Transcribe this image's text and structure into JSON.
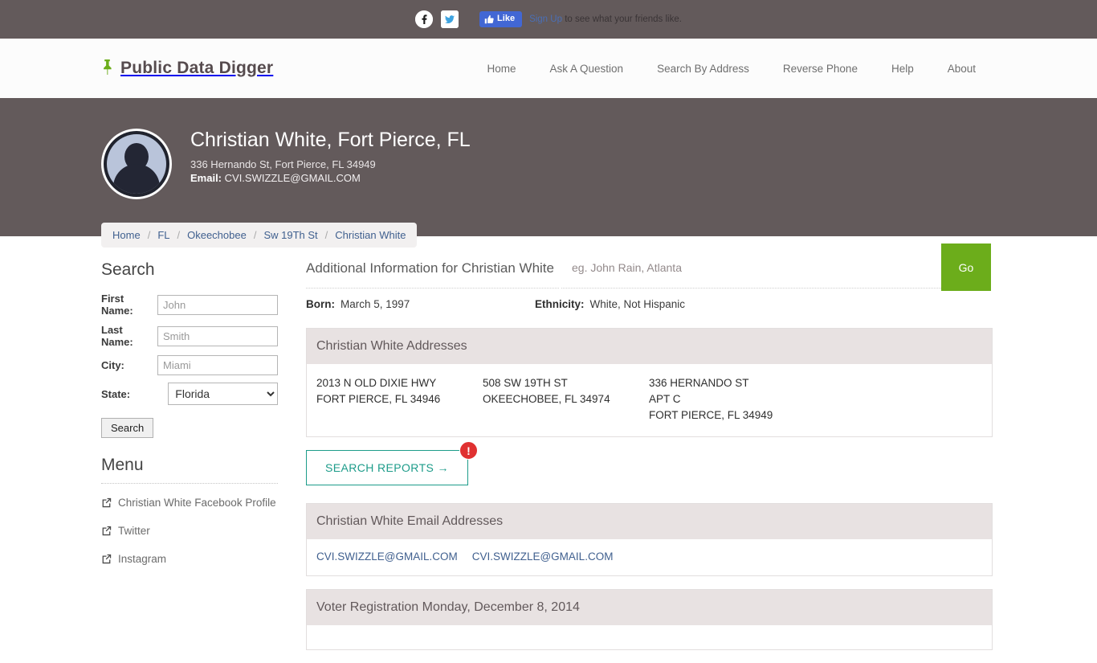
{
  "topbar": {
    "facebook_icon": "facebook-icon",
    "twitter_icon": "twitter-icon",
    "like_label": "Like",
    "signup_label": "Sign Up",
    "like_suffix": "to see what your friends like."
  },
  "header": {
    "brand": "Public Data Digger",
    "pin_icon": "pushpin-icon",
    "nav": [
      {
        "label": "Home"
      },
      {
        "label": "Ask A Question"
      },
      {
        "label": "Search By Address"
      },
      {
        "label": "Reverse Phone"
      },
      {
        "label": "Help"
      },
      {
        "label": "About"
      }
    ]
  },
  "hero": {
    "avatar_icon": "user-avatar-icon",
    "name": "Christian White, Fort Pierce, FL",
    "address": "336 Hernando St, Fort Pierce, FL 34949",
    "email_label": "Email:",
    "email": "CVI.SWIZZLE@GMAIL.COM",
    "search": {
      "placeholder": "eg. John Rain, Atlanta",
      "value": "",
      "button": "Go",
      "button_color": "#6cad1b"
    },
    "breadcrumb": [
      {
        "label": "Home"
      },
      {
        "label": "FL"
      },
      {
        "label": "Okeechobee"
      },
      {
        "label": "Sw 19Th St"
      },
      {
        "label": "Christian White"
      }
    ],
    "breadcrumb_separator": "/",
    "background_color": "#635a5b"
  },
  "sidebar": {
    "search_heading": "Search",
    "fields": [
      {
        "label": "First Name:",
        "placeholder": "John",
        "value": ""
      },
      {
        "label": "Last Name:",
        "placeholder": "Smith",
        "value": ""
      },
      {
        "label": "City:",
        "placeholder": "Miami",
        "value": ""
      }
    ],
    "state_label": "State:",
    "state_value": "Florida",
    "state_options": [
      "Florida"
    ],
    "search_button": "Search",
    "menu_heading": "Menu",
    "menu_items": [
      {
        "label": "Christian White Facebook Profile",
        "icon": "external-link-icon"
      },
      {
        "label": "Twitter",
        "icon": "external-link-icon"
      },
      {
        "label": "Instagram",
        "icon": "external-link-icon"
      }
    ]
  },
  "main": {
    "title": "Additional Information for Christian White",
    "born_label": "Born:",
    "born_value": "March 5, 1997",
    "ethnicity_label": "Ethnicity:",
    "ethnicity_value": "White, Not Hispanic",
    "addresses_panel": {
      "heading": "Christian White Addresses",
      "columns": [
        [
          "2013 N OLD DIXIE HWY",
          "FORT PIERCE, FL 34946"
        ],
        [
          "508 SW 19TH ST",
          "OKEECHOBEE, FL 34974"
        ],
        [
          "336 HERNANDO ST",
          "APT C",
          "FORT PIERCE, FL 34949"
        ]
      ]
    },
    "reports_button": {
      "label": "SEARCH REPORTS →",
      "badge": "!",
      "badge_color": "#e03131",
      "border_color": "#1d9c8a"
    },
    "emails_panel": {
      "heading": "Christian White Email Addresses",
      "emails": [
        "CVI.SWIZZLE@GMAIL.COM",
        "CVI.SWIZZLE@GMAIL.COM"
      ]
    },
    "voter_panel": {
      "heading": "Voter Registration Monday, December 8, 2014"
    }
  }
}
